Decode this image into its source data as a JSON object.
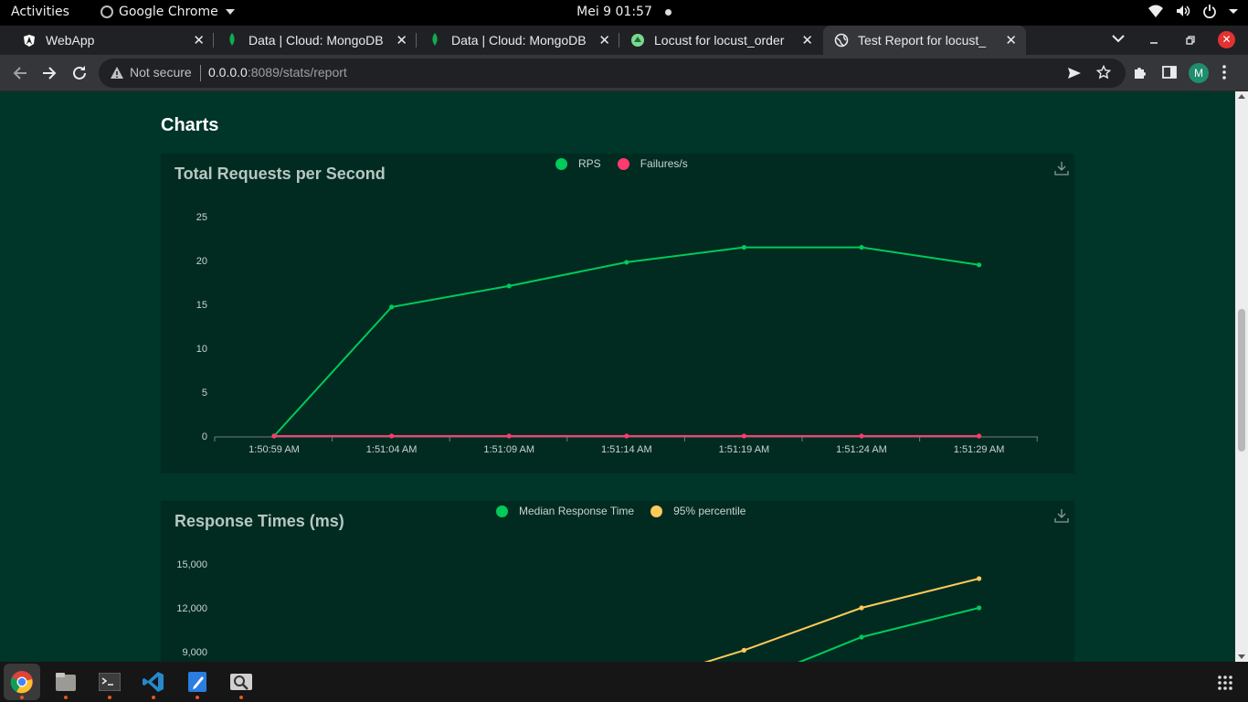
{
  "topbar": {
    "activities": "Activities",
    "app_name": "Google Chrome",
    "clock": "Mei 9  01:57"
  },
  "tabs": [
    {
      "title": "WebApp",
      "icon": "angular-icon"
    },
    {
      "title": "Data | Cloud: MongoDB",
      "icon": "mongodb-leaf-icon"
    },
    {
      "title": "Data | Cloud: MongoDB",
      "icon": "mongodb-leaf-icon"
    },
    {
      "title": "Locust for locust_order",
      "icon": "locust-icon"
    },
    {
      "title": "Test Report for locust_",
      "icon": "globe-icon",
      "active": true
    }
  ],
  "omnibox": {
    "security": "Not secure",
    "url_host": "0.0.0.0",
    "url_rest": ":8089/stats/report"
  },
  "profile_initial": "M",
  "page": {
    "section_title": "Charts"
  },
  "colors": {
    "page_bg": "#00352a",
    "panel_bg": "#012b21",
    "green": "#00ca5a",
    "red": "#ff3a6e",
    "yellow": "#ffca5a"
  },
  "chart_data": [
    {
      "type": "line",
      "title": "Total Requests per Second",
      "x": [
        "1:50:59 AM",
        "1:51:04 AM",
        "1:51:09 AM",
        "1:51:14 AM",
        "1:51:19 AM",
        "1:51:24 AM",
        "1:51:29 AM"
      ],
      "series": [
        {
          "name": "RPS",
          "color": "#00ca5a",
          "values": [
            0,
            14.7,
            17.1,
            19.8,
            21.5,
            21.5,
            19.5
          ]
        },
        {
          "name": "Failures/s",
          "color": "#ff3a6e",
          "values": [
            0,
            0,
            0,
            0,
            0,
            0,
            0
          ]
        }
      ],
      "ylim": [
        0,
        25
      ],
      "yticks": [
        "0",
        "5",
        "10",
        "15",
        "20",
        "25"
      ],
      "legend": "top-center",
      "grid": false
    },
    {
      "type": "line",
      "title": "Response Times (ms)",
      "series": [
        {
          "name": "Median Response Time",
          "color": "#00ca5a"
        },
        {
          "name": "95% percentile",
          "color": "#ffca5a"
        }
      ],
      "visible_points": {
        "95% percentile": [
          [
            "1:51:19 AM",
            9100
          ],
          [
            "1:51:24 AM",
            12000
          ],
          [
            "1:51:29 AM",
            14000
          ]
        ],
        "Median Response Time": [
          [
            "1:51:24 AM",
            10000
          ],
          [
            "1:51:29 AM",
            12000
          ]
        ]
      },
      "yticks": [
        "9,000",
        "12,000",
        "15,000"
      ],
      "legend": "top-center"
    }
  ]
}
